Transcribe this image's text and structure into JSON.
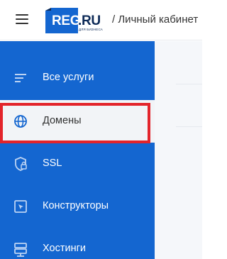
{
  "header": {
    "logo_main": "REG",
    "logo_domain": ".RU",
    "logo_tagline": "ДЛЯ БИЗНЕСА",
    "cabinet_title": "/ Личный кабинет"
  },
  "sidebar": {
    "items": [
      {
        "label": "Все услуги",
        "icon": "list-icon",
        "active": false
      },
      {
        "label": "Домены",
        "icon": "globe-icon",
        "active": true
      },
      {
        "label": "SSL",
        "icon": "shield-lock-icon",
        "active": false
      },
      {
        "label": "Конструкторы",
        "icon": "cursor-frame-icon",
        "active": false
      },
      {
        "label": "Хостинги",
        "icon": "server-icon",
        "active": false
      }
    ]
  },
  "colors": {
    "sidebar_bg": "#1466d0",
    "active_bg": "#f2f4f7",
    "highlight": "#e3242b",
    "logo_blue": "#1466d0",
    "logo_dark": "#0d2a57"
  }
}
